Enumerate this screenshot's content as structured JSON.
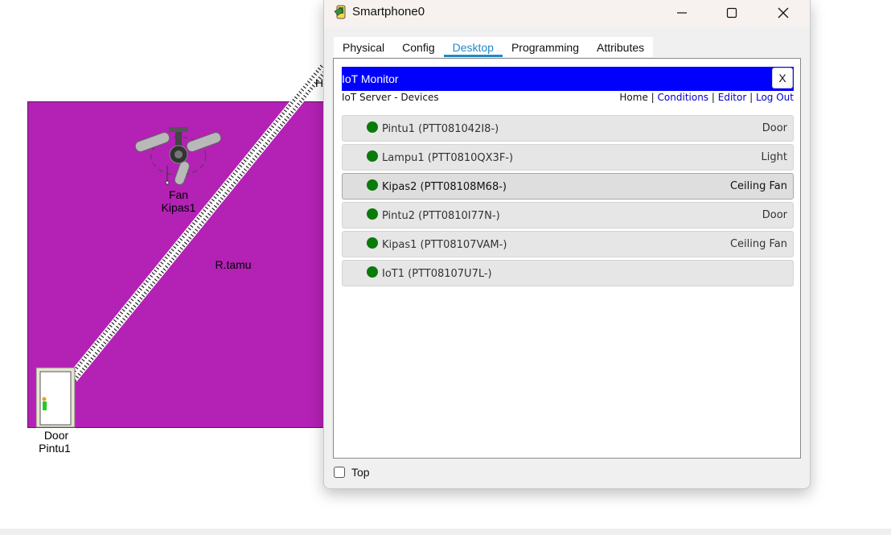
{
  "workspace": {
    "room_label": "R.tamu",
    "fan": {
      "type": "Fan",
      "name": "Kipas1",
      "icon": "ceiling-fan-icon"
    },
    "door": {
      "type": "Door",
      "name": "Pintu1",
      "icon": "door-icon"
    },
    "partial_label": "H",
    "room_color": "#b321b5"
  },
  "window": {
    "title": "Smartphone0",
    "icon": "smartphone-icon",
    "controls": {
      "minimize": "minimize-icon",
      "maximize": "maximize-icon",
      "close": "close-icon"
    },
    "tabs": [
      {
        "label": "Physical",
        "active": false
      },
      {
        "label": "Config",
        "active": false
      },
      {
        "label": "Desktop",
        "active": true
      },
      {
        "label": "Programming",
        "active": false
      },
      {
        "label": "Attributes",
        "active": false
      }
    ],
    "top_checkbox": {
      "label": "Top",
      "checked": false
    }
  },
  "iot": {
    "title": "IoT Monitor",
    "close_label": "X",
    "subtitle": "IoT Server - Devices",
    "nav": {
      "home": "Home",
      "sep": "|",
      "conditions": "Conditions",
      "editor": "Editor",
      "logout": "Log Out"
    },
    "header_color": "#0000ff",
    "status_color": "#0a7a0a",
    "devices": [
      {
        "name": "Pintu1 (PTT081042I8-)",
        "type": "Door",
        "selected": false
      },
      {
        "name": "Lampu1 (PTT0810QX3F-)",
        "type": "Light",
        "selected": false
      },
      {
        "name": "Kipas2 (PTT08108M68-)",
        "type": "Ceiling Fan",
        "selected": true
      },
      {
        "name": "Pintu2 (PTT0810I77N-)",
        "type": "Door",
        "selected": false
      },
      {
        "name": "Kipas1 (PTT08107VAM-)",
        "type": "Ceiling Fan",
        "selected": false
      },
      {
        "name": "IoT1 (PTT08107U7L-)",
        "type": "",
        "selected": false
      }
    ]
  }
}
